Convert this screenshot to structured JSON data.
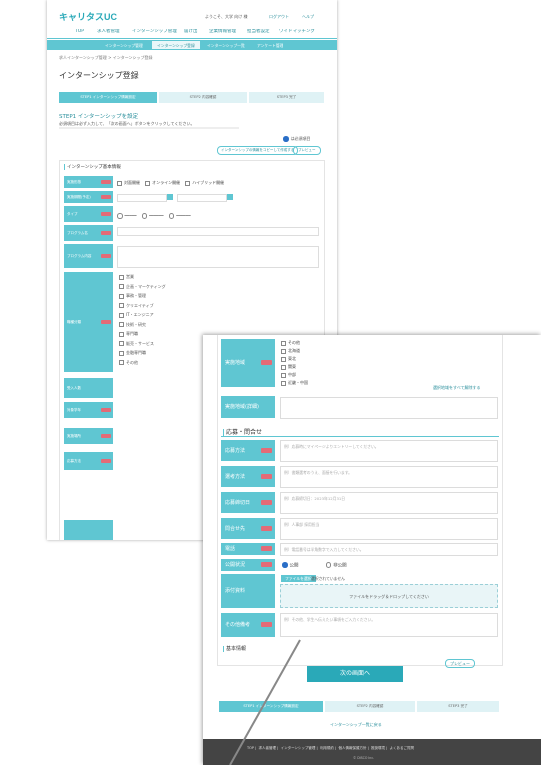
{
  "back": {
    "logo_main": "キャリタス",
    "logo_accent": "UC",
    "header_right": [
      "ようこそ、大学 向け 様",
      "ログアウト",
      "ヘルプ"
    ],
    "nav1": [
      "TOP",
      "求人者管理",
      "インターンシップ管理",
      "届け出",
      "企業情報管理",
      "担当者設定",
      "ワイドマッチング"
    ],
    "nav2": [
      "インターンシップ管理",
      "インターンシップ登録",
      "インターンシップ一覧",
      "アンケート管理"
    ],
    "breadcrumb": "求人インターンシップ管理 > インターンシップ登録",
    "page_title": "インターンシップ登録",
    "steps": [
      "STEP1 インターンシップ情報設定",
      "STEP2 内容確認",
      "STEP3 完了"
    ],
    "section_heading": "STEP1 インターンシップを設定",
    "intro": "必須項目は必ず入力して、「次の画面へ」ボタンをクリックしてください。",
    "copy_button": "インターンシップの情報をコピーして作成する",
    "preview_button": "プレビュー",
    "group_title": "インターンシップ基本情報",
    "fields": [
      {
        "label": "実施形態",
        "options": [
          "対面開催",
          "オンライン開催",
          "ハイブリッド開催"
        ]
      },
      {
        "label": "実施期間(予定)"
      },
      {
        "label": "タイプ"
      },
      {
        "label": "プログラム名"
      },
      {
        "label": "プログラム内容"
      },
      {
        "label": "職種分類"
      },
      {
        "label": "受入人数"
      },
      {
        "label": "対象学年"
      },
      {
        "label": "実施場所"
      },
      {
        "label": "応募方法"
      }
    ],
    "categories": [
      "営業",
      "企画・マーケティング",
      "事務・管理",
      "クリエイティブ",
      "IT・エンジニア",
      "技術・研究",
      "専門職",
      "販売・サービス",
      "金融専門職",
      "その他"
    ]
  },
  "front": {
    "area_label": "実施地域",
    "areas": [
      "その他",
      "北海道",
      "東北",
      "関東",
      "中部",
      "近畿・中国"
    ],
    "area_link": "選択地域をすべて解除する",
    "remarks_label": "実施地域(詳細)",
    "section_title": "応募・問合せ",
    "fields": [
      {
        "label": "応募方法",
        "placeholder": "例）応募時にマイページよりエントリーしてください。"
      },
      {
        "label": "選考方法",
        "placeholder": "例）書類選考のうえ、面接を行います。"
      },
      {
        "label": "応募締切日",
        "placeholder": "例）応募締切日：2023年12月31日"
      },
      {
        "label": "問合せ先",
        "placeholder": "例）人事部 採用担当"
      },
      {
        "label": "電話",
        "placeholder": "例）電話番号は半角数字で入力してください。"
      }
    ],
    "availability_label": "公開状況",
    "radio_options": [
      "公開",
      "非公開"
    ],
    "upload_label": "添付資料",
    "upload_button": "ファイルを選択",
    "upload_note": "選択されていません",
    "drop_text": "ファイルをドラッグ＆ドロップしてください",
    "notes_label": "その他備考",
    "notes_placeholder": "例）その他、学生へ伝えたい事項をご入力ください。",
    "basic_info": "基本情報",
    "preview_button": "プレビュー",
    "next_button": "次の画面へ",
    "steps": [
      "STEP1 インターンシップ情報設定",
      "STEP2 内容確認",
      "STEP3 完了"
    ],
    "back_link": "インターンシップ一覧に戻る",
    "footer_links": [
      "TOP",
      "求人者管理",
      "インターンシップ管理",
      "利用規約",
      "個人情報保護方針",
      "推奨環境",
      "よくあるご質問"
    ],
    "copyright": "© DISCO Inc."
  },
  "colors": {
    "teal": "#5fc6d2",
    "teal_dark": "#2a8f9c",
    "required": "#e36b77",
    "footer": "#444444"
  }
}
